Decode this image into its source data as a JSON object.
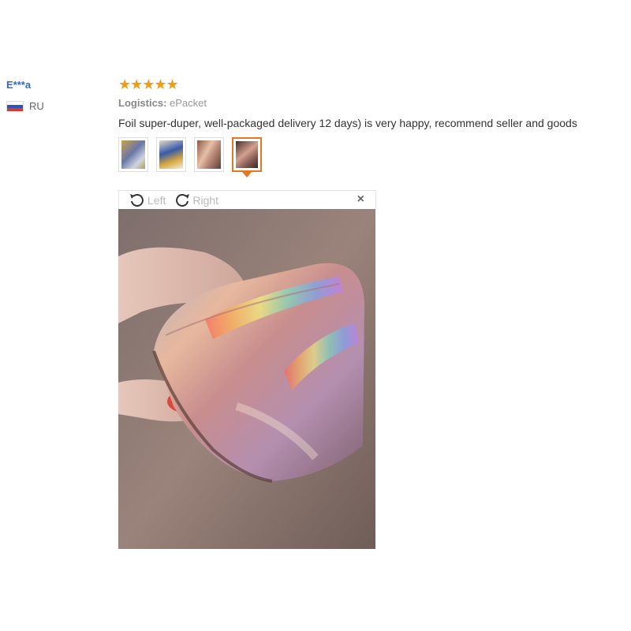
{
  "reviewer": {
    "name": "E***a",
    "country": "RU",
    "flag_icon": "russia-flag-icon"
  },
  "review": {
    "rating": 5,
    "rating_max": 5,
    "stars": "★★★★★",
    "star_color": "#f39c12",
    "logistics_label": "Logistics:",
    "logistics_value": "ePacket",
    "feedback": "Foil super-duper, well-packaged delivery 12 days) is very happy, recommend seller and goods"
  },
  "thumbnails": {
    "count": 4,
    "active_index": 3
  },
  "viewer": {
    "rotate_left_label": "Left",
    "rotate_right_label": "Right",
    "rotate_left_icon": "rotate-left-icon",
    "rotate_right_icon": "rotate-right-icon",
    "close_label": "×",
    "close_icon": "close-icon"
  },
  "colors": {
    "accent": "#e87722",
    "name_link": "#2f6bc4"
  }
}
